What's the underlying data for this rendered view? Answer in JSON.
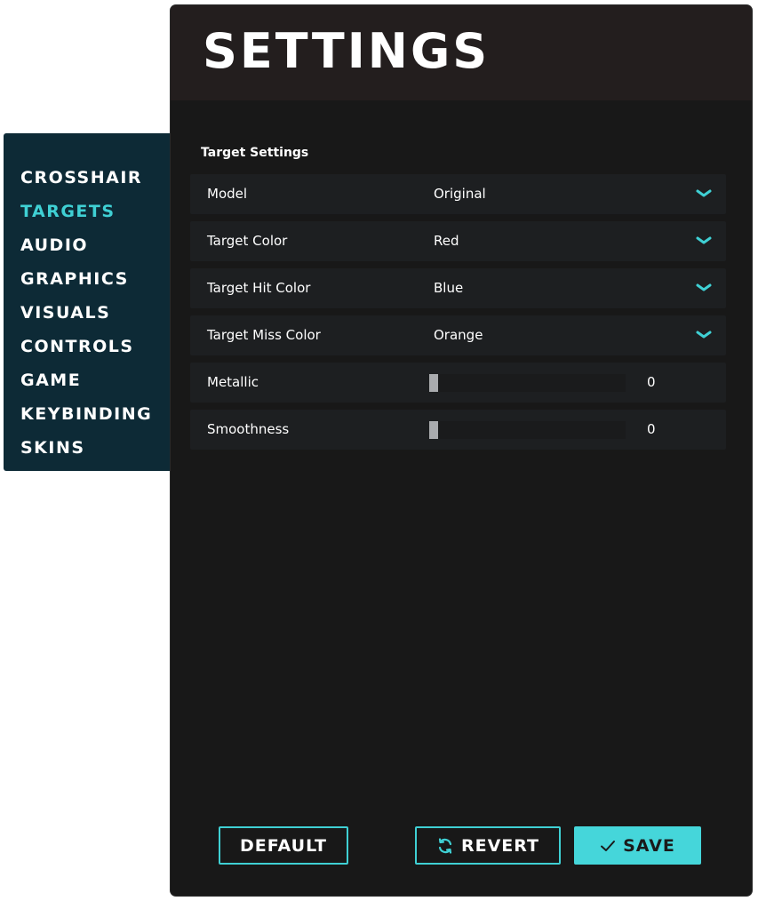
{
  "nav": {
    "items": [
      {
        "label": "CROSSHAIR",
        "active": false
      },
      {
        "label": "TARGETS",
        "active": true
      },
      {
        "label": "AUDIO",
        "active": false
      },
      {
        "label": "GRAPHICS",
        "active": false
      },
      {
        "label": "VISUALS",
        "active": false
      },
      {
        "label": "CONTROLS",
        "active": false
      },
      {
        "label": "GAME",
        "active": false
      },
      {
        "label": "KEYBINDING",
        "active": false
      },
      {
        "label": "SKINS",
        "active": false
      }
    ]
  },
  "header": {
    "title": "SETTINGS"
  },
  "section": {
    "title": "Target Settings"
  },
  "rows": [
    {
      "label": "Model",
      "value": "Original",
      "type": "dropdown"
    },
    {
      "label": "Target Color",
      "value": "Red",
      "type": "dropdown"
    },
    {
      "label": "Target Hit Color",
      "value": "Blue",
      "type": "dropdown"
    },
    {
      "label": "Target Miss Color",
      "value": "Orange",
      "type": "dropdown"
    },
    {
      "label": "Metallic",
      "value": "0",
      "type": "slider"
    },
    {
      "label": "Smoothness",
      "value": "0",
      "type": "slider"
    }
  ],
  "buttons": {
    "default_label": "DEFAULT",
    "revert_label": "REVERT",
    "save_label": "SAVE"
  },
  "icons": {
    "dropdown": "chevron-down-icon",
    "revert": "refresh-icon",
    "save": "check-icon"
  },
  "colors": {
    "accent": "#3fd0d4",
    "nav_bg": "#0d2a36",
    "panel_bg": "#181818",
    "header_bg": "#231e1e"
  }
}
